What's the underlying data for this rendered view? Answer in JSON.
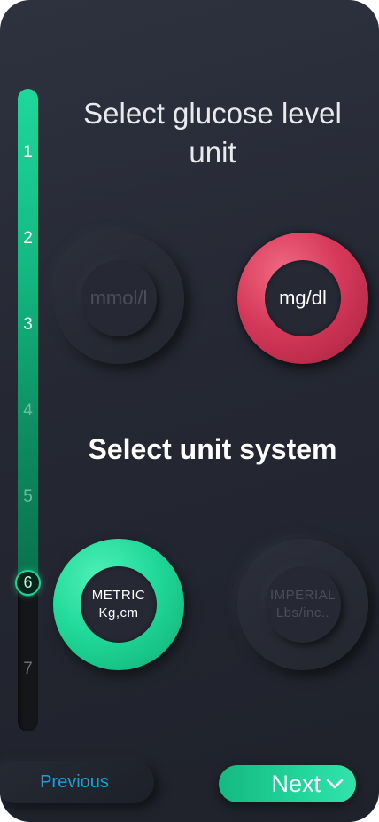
{
  "steps": {
    "labels": [
      "1",
      "2",
      "3",
      "4",
      "5",
      "6",
      "7"
    ],
    "current": "6"
  },
  "glucose": {
    "title": "Select glucose level unit",
    "title_line1": "Select glucose level",
    "title_line2": "unit",
    "options": [
      {
        "label": "mmol/l",
        "selected": false
      },
      {
        "label": "mg/dl",
        "selected": true
      }
    ]
  },
  "units": {
    "title": "Select unit system",
    "options": [
      {
        "line1": "METRIC",
        "line2": "Kg,cm",
        "selected": true
      },
      {
        "line1": "IMPERIAL",
        "line2": "Lbs/inc..",
        "selected": false
      }
    ]
  },
  "nav": {
    "previous_label": "Previous",
    "next_label": "Next"
  },
  "colors": {
    "accent_green": "#22d59a",
    "accent_red": "#d6395a",
    "link_blue": "#1aa0d8",
    "background": "#252833"
  }
}
